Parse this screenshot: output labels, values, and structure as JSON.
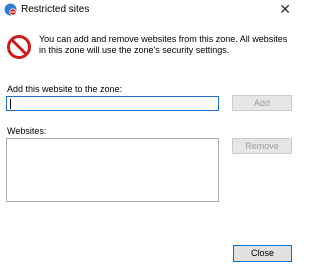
{
  "window": {
    "title": "Restricted sites",
    "close_symbol": "✕"
  },
  "info": {
    "icon": "restricted-icon",
    "text": "You can add and remove websites from this zone. All websites in this zone will use the zone's security settings."
  },
  "add_section": {
    "label": "Add this website to the zone:",
    "input_value": "",
    "add_button": "Add"
  },
  "websites": {
    "label": "Websites:",
    "items": [],
    "remove_button": "Remove"
  },
  "footer": {
    "close_button": "Close"
  },
  "colors": {
    "accent": "#0078d7",
    "restricted_red": "#d11a1a"
  }
}
